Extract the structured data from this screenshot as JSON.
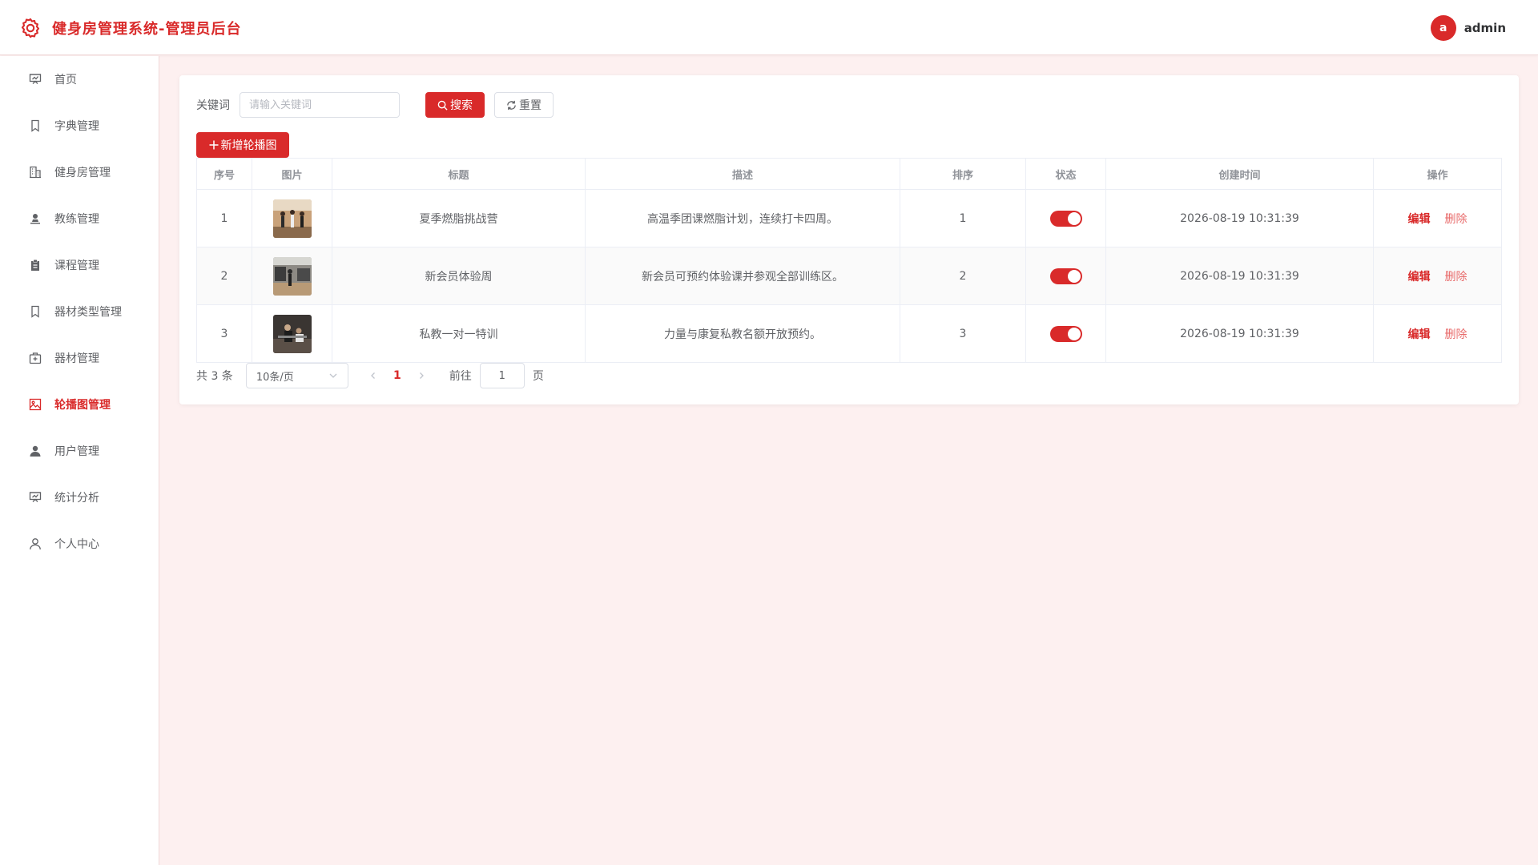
{
  "app": {
    "title": "健身房管理系统-管理员后台",
    "accent": "#d92a2a"
  },
  "user": {
    "avatar_letter": "a",
    "name": "admin"
  },
  "sidebar": {
    "active_index": 7,
    "items": [
      {
        "label": "首页",
        "icon": "presentation-chart-icon"
      },
      {
        "label": "字典管理",
        "icon": "bookmark-icon"
      },
      {
        "label": "健身房管理",
        "icon": "building-icon"
      },
      {
        "label": "教练管理",
        "icon": "person-stamp-icon"
      },
      {
        "label": "课程管理",
        "icon": "clipboard-icon"
      },
      {
        "label": "器材类型管理",
        "icon": "bookmark-icon"
      },
      {
        "label": "器材管理",
        "icon": "first-aid-kit-icon"
      },
      {
        "label": "轮播图管理",
        "icon": "picture-icon"
      },
      {
        "label": "用户管理",
        "icon": "user-filled-icon"
      },
      {
        "label": "统计分析",
        "icon": "presentation-chart-icon"
      },
      {
        "label": "个人中心",
        "icon": "user-outline-icon"
      }
    ]
  },
  "search": {
    "label": "关键词",
    "placeholder": "请输入关键词",
    "value": "",
    "search_label": "搜索",
    "reset_label": "重置"
  },
  "add_button_label": "新增轮播图",
  "table": {
    "columns": [
      "序号",
      "图片",
      "标题",
      "描述",
      "排序",
      "状态",
      "创建时间",
      "操作"
    ],
    "rows": [
      {
        "index": "1",
        "image": "gym-class-photo",
        "title": "夏季燃脂挑战营",
        "desc": "高温季团课燃脂计划，连续打卡四周。",
        "sort": "1",
        "status_on": true,
        "created": "2026-08-19 10:31:39"
      },
      {
        "index": "2",
        "image": "gym-floor-photo",
        "title": "新会员体验周",
        "desc": "新会员可预约体验课并参观全部训练区。",
        "sort": "2",
        "status_on": true,
        "created": "2026-08-19 10:31:39"
      },
      {
        "index": "3",
        "image": "personal-training-photo",
        "title": "私教一对一特训",
        "desc": "力量与康复私教名额开放预约。",
        "sort": "3",
        "status_on": true,
        "created": "2026-08-19 10:31:39"
      }
    ],
    "edit_label": "编辑",
    "delete_label": "删除"
  },
  "pagination": {
    "total_text": "共 3 条",
    "page_size": "10条/页",
    "current_page": "1",
    "goto_label": "前往",
    "goto_value": "1",
    "page_suffix": "页"
  }
}
